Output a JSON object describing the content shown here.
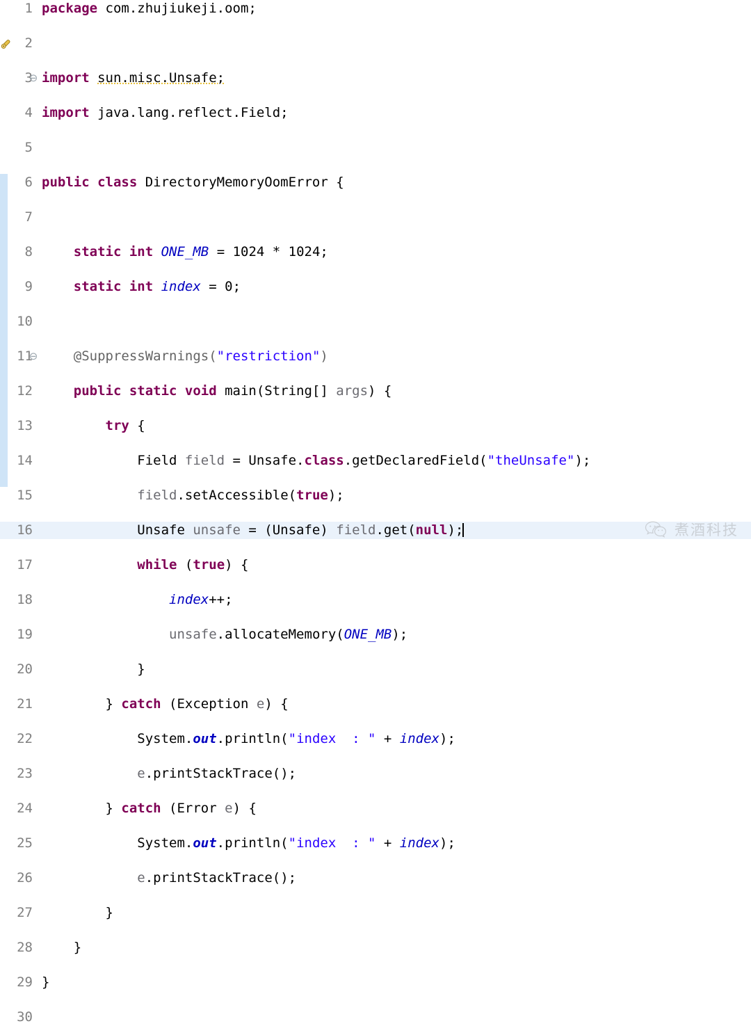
{
  "app": {
    "kind": "java-code-editor",
    "theme": "eclipse-default-light",
    "total_lines": 30,
    "current_line": 16
  },
  "colors": {
    "background": "#ffffff",
    "keyword": "#7f0055",
    "string": "#2a00ff",
    "static_field": "#0000c0",
    "local_var": "#6a6a70",
    "annotation": "#646464",
    "line_number": "#808080",
    "current_line_highlight": "#eaf2fb",
    "change_bar": "#cfe4f7",
    "warning_squiggle": "#e8c13a",
    "watermark": "#9b9b9b"
  },
  "gutter": {
    "warning_marker_line": 3,
    "fold_markers": [
      3,
      11
    ],
    "fold_glyph": "⊖",
    "change_bar_from_line": 11,
    "change_bar_to_line": 28
  },
  "watermark": {
    "icon": "wechat-icon",
    "text": "煮酒科技"
  },
  "lines": [
    {
      "n": 1,
      "tokens": [
        {
          "t": "package ",
          "c": "kw"
        },
        {
          "t": "com.zhujiukeji.oom;",
          "c": "plain"
        }
      ]
    },
    {
      "n": 2,
      "tokens": []
    },
    {
      "n": 3,
      "fold": true,
      "warn": true,
      "tokens": [
        {
          "t": "import ",
          "c": "kw"
        },
        {
          "t": "sun.misc.Unsafe;",
          "c": "sq"
        }
      ]
    },
    {
      "n": 4,
      "tokens": [
        {
          "t": "import ",
          "c": "kw"
        },
        {
          "t": "java.lang.reflect.Field;",
          "c": "plain"
        }
      ]
    },
    {
      "n": 5,
      "tokens": []
    },
    {
      "n": 6,
      "tokens": [
        {
          "t": "public class ",
          "c": "kw"
        },
        {
          "t": "DirectoryMemoryOomError {",
          "c": "plain"
        }
      ]
    },
    {
      "n": 7,
      "tokens": []
    },
    {
      "n": 8,
      "tokens": [
        {
          "t": "    ",
          "c": "plain"
        },
        {
          "t": "static int ",
          "c": "kw"
        },
        {
          "t": "ONE_MB",
          "c": "fld"
        },
        {
          "t": " = 1024 * 1024;",
          "c": "plain"
        }
      ]
    },
    {
      "n": 9,
      "tokens": [
        {
          "t": "    ",
          "c": "plain"
        },
        {
          "t": "static int ",
          "c": "kw"
        },
        {
          "t": "index",
          "c": "fld"
        },
        {
          "t": " = 0;",
          "c": "plain"
        }
      ]
    },
    {
      "n": 10,
      "tokens": []
    },
    {
      "n": 11,
      "fold": true,
      "tokens": [
        {
          "t": "    ",
          "c": "plain"
        },
        {
          "t": "@SuppressWarnings(",
          "c": "ann"
        },
        {
          "t": "\"restriction\"",
          "c": "str"
        },
        {
          "t": ")",
          "c": "ann"
        }
      ]
    },
    {
      "n": 12,
      "tokens": [
        {
          "t": "    ",
          "c": "plain"
        },
        {
          "t": "public static void ",
          "c": "kw"
        },
        {
          "t": "main(String[] ",
          "c": "plain"
        },
        {
          "t": "args",
          "c": "lcl"
        },
        {
          "t": ") {",
          "c": "plain"
        }
      ]
    },
    {
      "n": 13,
      "tokens": [
        {
          "t": "        ",
          "c": "plain"
        },
        {
          "t": "try",
          "c": "kw"
        },
        {
          "t": " {",
          "c": "plain"
        }
      ]
    },
    {
      "n": 14,
      "tokens": [
        {
          "t": "            Field ",
          "c": "plain"
        },
        {
          "t": "field",
          "c": "lcl"
        },
        {
          "t": " = Unsafe.",
          "c": "plain"
        },
        {
          "t": "class",
          "c": "kw"
        },
        {
          "t": ".getDeclaredField(",
          "c": "plain"
        },
        {
          "t": "\"theUnsafe\"",
          "c": "str"
        },
        {
          "t": ");",
          "c": "plain"
        }
      ]
    },
    {
      "n": 15,
      "tokens": [
        {
          "t": "            ",
          "c": "plain"
        },
        {
          "t": "field",
          "c": "lcl"
        },
        {
          "t": ".setAccessible(",
          "c": "plain"
        },
        {
          "t": "true",
          "c": "kw"
        },
        {
          "t": ");",
          "c": "plain"
        }
      ]
    },
    {
      "n": 16,
      "current": true,
      "caret": true,
      "tokens": [
        {
          "t": "            Unsafe ",
          "c": "plain"
        },
        {
          "t": "unsafe",
          "c": "lcl"
        },
        {
          "t": " = (Unsafe) ",
          "c": "plain"
        },
        {
          "t": "field",
          "c": "lcl"
        },
        {
          "t": ".get(",
          "c": "plain"
        },
        {
          "t": "null",
          "c": "kw"
        },
        {
          "t": ");",
          "c": "plain"
        }
      ]
    },
    {
      "n": 17,
      "tokens": [
        {
          "t": "            ",
          "c": "plain"
        },
        {
          "t": "while",
          "c": "kw"
        },
        {
          "t": " (",
          "c": "plain"
        },
        {
          "t": "true",
          "c": "kw"
        },
        {
          "t": ") {",
          "c": "plain"
        }
      ]
    },
    {
      "n": 18,
      "tokens": [
        {
          "t": "                ",
          "c": "plain"
        },
        {
          "t": "index",
          "c": "fld"
        },
        {
          "t": "++;",
          "c": "plain"
        }
      ]
    },
    {
      "n": 19,
      "tokens": [
        {
          "t": "                ",
          "c": "plain"
        },
        {
          "t": "unsafe",
          "c": "lcl"
        },
        {
          "t": ".allocateMemory(",
          "c": "plain"
        },
        {
          "t": "ONE_MB",
          "c": "fld"
        },
        {
          "t": ");",
          "c": "plain"
        }
      ]
    },
    {
      "n": 20,
      "tokens": [
        {
          "t": "            }",
          "c": "plain"
        }
      ]
    },
    {
      "n": 21,
      "tokens": [
        {
          "t": "        } ",
          "c": "plain"
        },
        {
          "t": "catch",
          "c": "kw"
        },
        {
          "t": " (Exception ",
          "c": "plain"
        },
        {
          "t": "e",
          "c": "lcl"
        },
        {
          "t": ") {",
          "c": "plain"
        }
      ]
    },
    {
      "n": 22,
      "tokens": [
        {
          "t": "            System.",
          "c": "plain"
        },
        {
          "t": "out",
          "c": "fldb"
        },
        {
          "t": ".println(",
          "c": "plain"
        },
        {
          "t": "\"index  : \"",
          "c": "str"
        },
        {
          "t": " + ",
          "c": "plain"
        },
        {
          "t": "index",
          "c": "fld"
        },
        {
          "t": ");",
          "c": "plain"
        }
      ]
    },
    {
      "n": 23,
      "tokens": [
        {
          "t": "            ",
          "c": "plain"
        },
        {
          "t": "e",
          "c": "lcl"
        },
        {
          "t": ".printStackTrace();",
          "c": "plain"
        }
      ]
    },
    {
      "n": 24,
      "tokens": [
        {
          "t": "        } ",
          "c": "plain"
        },
        {
          "t": "catch",
          "c": "kw"
        },
        {
          "t": " (Error ",
          "c": "plain"
        },
        {
          "t": "e",
          "c": "lcl"
        },
        {
          "t": ") {",
          "c": "plain"
        }
      ]
    },
    {
      "n": 25,
      "tokens": [
        {
          "t": "            System.",
          "c": "plain"
        },
        {
          "t": "out",
          "c": "fldb"
        },
        {
          "t": ".println(",
          "c": "plain"
        },
        {
          "t": "\"index  : \"",
          "c": "str"
        },
        {
          "t": " + ",
          "c": "plain"
        },
        {
          "t": "index",
          "c": "fld"
        },
        {
          "t": ");",
          "c": "plain"
        }
      ]
    },
    {
      "n": 26,
      "tokens": [
        {
          "t": "            ",
          "c": "plain"
        },
        {
          "t": "e",
          "c": "lcl"
        },
        {
          "t": ".printStackTrace();",
          "c": "plain"
        }
      ]
    },
    {
      "n": 27,
      "tokens": [
        {
          "t": "        }",
          "c": "plain"
        }
      ]
    },
    {
      "n": 28,
      "tokens": [
        {
          "t": "    }",
          "c": "plain"
        }
      ]
    },
    {
      "n": 29,
      "tokens": [
        {
          "t": "}",
          "c": "plain"
        }
      ]
    },
    {
      "n": 30,
      "tokens": []
    }
  ]
}
